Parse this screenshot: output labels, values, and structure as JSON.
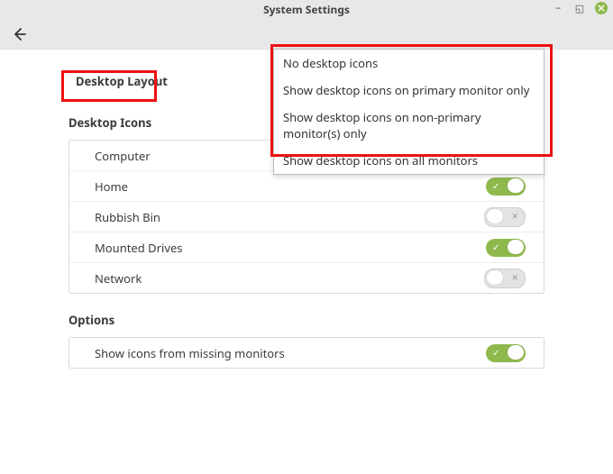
{
  "window": {
    "title": "System Settings"
  },
  "section": {
    "heading": "Desktop Layout",
    "icons_heading": "Desktop Icons",
    "options_heading": "Options"
  },
  "dropdown": {
    "items": [
      "No desktop icons",
      "Show desktop icons on primary monitor only",
      "Show desktop icons on non-primary monitor(s) only",
      "Show desktop icons on all monitors"
    ]
  },
  "icons": [
    {
      "label": "Computer",
      "state": "none"
    },
    {
      "label": "Home",
      "state": "on"
    },
    {
      "label": "Rubbish Bin",
      "state": "off"
    },
    {
      "label": "Mounted Drives",
      "state": "on"
    },
    {
      "label": "Network",
      "state": "off"
    }
  ],
  "options": [
    {
      "label": "Show icons from missing monitors",
      "state": "on"
    }
  ]
}
